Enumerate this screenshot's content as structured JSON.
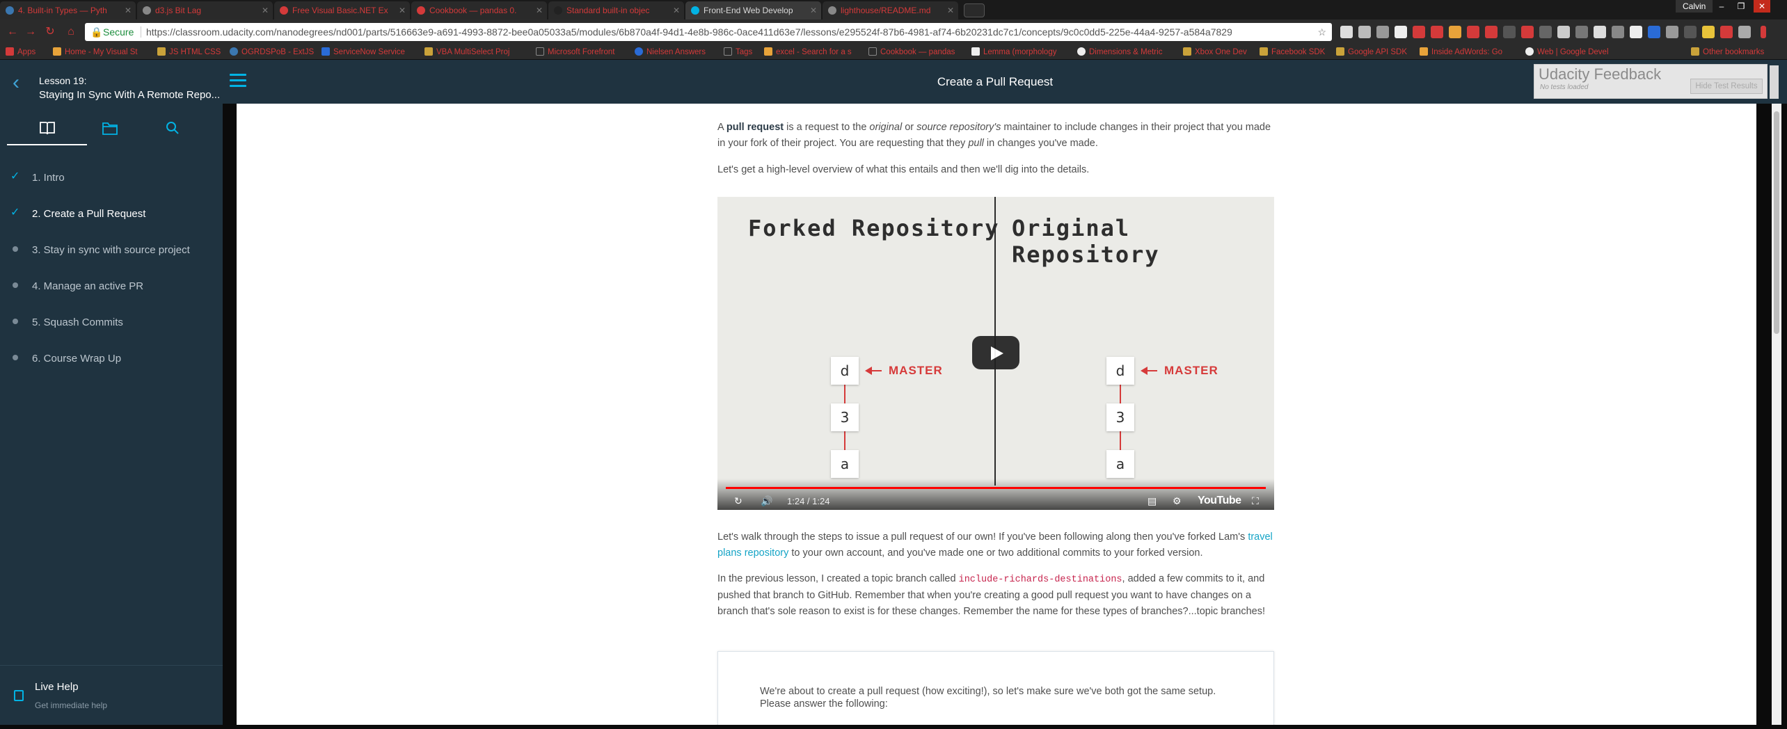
{
  "browser": {
    "tabs": [
      {
        "label": "4. Built-in Types — Pyth",
        "color": "#3b77b0"
      },
      {
        "label": "d3.js Bit Lag",
        "color": "#888888"
      },
      {
        "label": "Free Visual Basic.NET Ex",
        "color": "#d43a3a"
      },
      {
        "label": "Cookbook — pandas 0.",
        "color": "#d43a3a"
      },
      {
        "label": "Standard built-in objec",
        "color": "#222222"
      },
      {
        "label": "Front-End Web Develop",
        "color": "#02b3e4"
      },
      {
        "label": "lighthouse/README.md",
        "color": "#888888"
      }
    ],
    "profile": "Calvin",
    "address": {
      "secure_label": "Secure",
      "url": "https://classroom.udacity.com/nanodegrees/nd001/parts/516663e9-a691-4993-8872-bee0a05033a5/modules/6b870a4f-94d1-4e8b-986c-0ace411d63e7/lessons/e295524f-87b6-4981-af74-6b20231dc7c1/concepts/9c0c0dd5-225e-44a4-9257-a584a7829207"
    },
    "bookmarks": [
      "Apps",
      "Home - My Visual St",
      "JS HTML CSS",
      "OGRDSPoB - ExtJS",
      "ServiceNow Service",
      "VBA MultiSelect Proj",
      "Microsoft Forefront",
      "Nielsen Answers",
      "Tags",
      "excel - Search for a s",
      "Cookbook — pandas",
      "Lemma (morphology",
      "Dimensions & Metric",
      "Xbox One Dev",
      "Facebook SDK",
      "Google API SDK",
      "Inside AdWords: Go",
      "Web | Google Devel",
      "Other bookmarks"
    ]
  },
  "app": {
    "lesson_label": "Lesson 19:",
    "lesson_title": "Staying In Sync With A Remote Repo...",
    "page_title": "Create a Pull Request",
    "feedback": {
      "title": "Udacity Feedback",
      "subtitle": "No tests loaded",
      "button": "Hide Test Results"
    }
  },
  "sidebar": {
    "concepts": [
      {
        "label": "1. Intro",
        "state": "done"
      },
      {
        "label": "2. Create a Pull Request",
        "state": "current"
      },
      {
        "label": "3. Stay in sync with source project",
        "state": "todo"
      },
      {
        "label": "4. Manage an active PR",
        "state": "todo"
      },
      {
        "label": "5. Squash Commits",
        "state": "todo"
      },
      {
        "label": "6. Course Wrap Up",
        "state": "todo"
      }
    ],
    "live_help": {
      "title": "Live Help",
      "subtitle": "Get immediate help"
    }
  },
  "content": {
    "p1": {
      "t1": "A ",
      "b1": "pull request",
      "t2": " is a request to the ",
      "i1": "original",
      "t3": " or ",
      "i2": "source repository's",
      "t4": " maintainer to include changes in their project that you made in your fork of their project. You are requesting that they ",
      "i3": "pull",
      "t5": " in changes you've made."
    },
    "p2": "Let's get a high-level overview of what this entails and then we'll dig into the details.",
    "video": {
      "left_title": "Forked Repository",
      "right_title": "Original Repository",
      "commits": [
        "d",
        "3",
        "a"
      ],
      "master_label": "MASTER",
      "time": "1:24 / 1:24",
      "brand": "YouTube"
    },
    "p3": {
      "t1": "Let's walk through the steps to issue a pull request of our own! If you've been following along then you've forked Lam's ",
      "link": "travel plans repository",
      "t2": " to your own account, and you've made one or two additional commits to your forked version."
    },
    "p4": {
      "t1": "In the previous lesson, I created a topic branch called ",
      "code": "include-richards-destinations",
      "t2": ", added a few commits to it, and pushed that branch to GitHub. Remember that when you're creating a good pull request you want to have changes on a branch that's sole reason to exist is for these changes. Remember the name for these types of branches?...topic branches!"
    },
    "quiz": "We're about to create a pull request (how exciting!), so let's make sure we've both got the same setup. Please answer the following:"
  }
}
